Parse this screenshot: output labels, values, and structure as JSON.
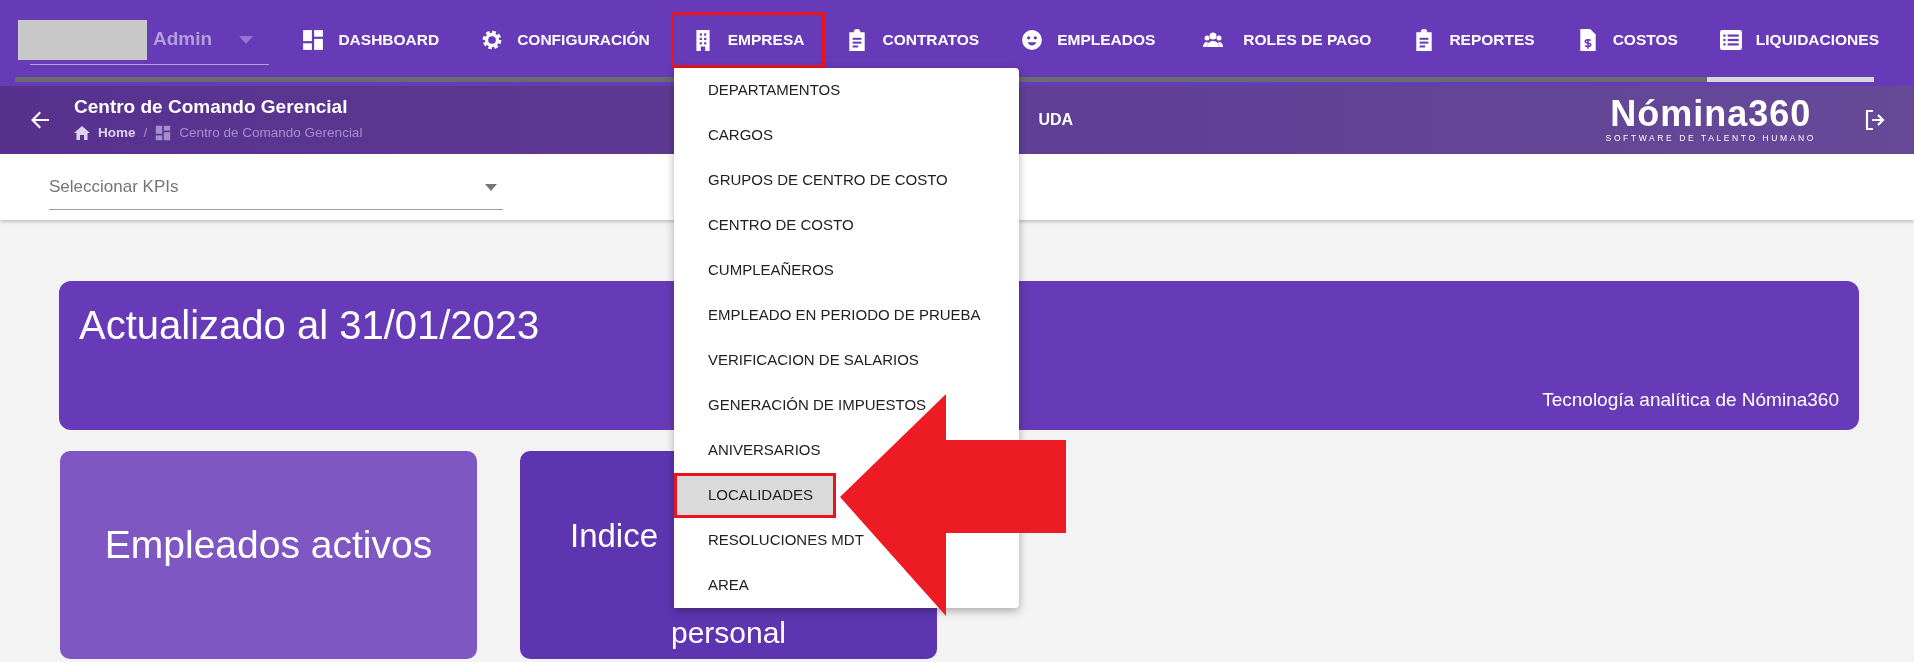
{
  "user": {
    "name": "Admin"
  },
  "nav": [
    {
      "label": "DASHBOARD",
      "highlighted": false
    },
    {
      "label": "CONFIGURACIÓN",
      "highlighted": false
    },
    {
      "label": "EMPRESA",
      "highlighted": true
    },
    {
      "label": "CONTRATOS",
      "highlighted": false
    },
    {
      "label": "EMPLEADOS",
      "highlighted": false
    },
    {
      "label": "ROLES DE PAGO",
      "highlighted": false
    },
    {
      "label": "REPORTES",
      "highlighted": false
    },
    {
      "label": "COSTOS",
      "highlighted": false
    },
    {
      "label": "LIQUIDACIONES",
      "highlighted": false
    }
  ],
  "progress": {
    "level": 0.91
  },
  "header": {
    "title": "Centro de Comando Gerencial",
    "breadcrumb": [
      "Home",
      "/",
      "Centro de Comando Gerencial"
    ],
    "partial_link": "UDA",
    "logo": "Nómina360",
    "logo_tagline": "SOFTWARE DE TALENTO HUMANO"
  },
  "kpi_select": {
    "placeholder": "Seleccionar KPIs"
  },
  "banner": {
    "title": "Actualizado al 31/01/2023",
    "caption": "Tecnología analítica de Nómina360"
  },
  "cards": [
    {
      "lines": [
        "Empleados activos"
      ]
    },
    {
      "lines": [
        "Indice",
        "personal"
      ]
    }
  ],
  "dropdown": [
    {
      "label": "DEPARTAMENTOS",
      "highlighted": false
    },
    {
      "label": "CARGOS",
      "highlighted": false
    },
    {
      "label": "GRUPOS DE CENTRO DE COSTO",
      "highlighted": false
    },
    {
      "label": "CENTRO DE COSTO",
      "highlighted": false
    },
    {
      "label": "CUMPLEAÑEROS",
      "highlighted": false
    },
    {
      "label": "EMPLEADO EN PERIODO DE PRUEBA",
      "highlighted": false
    },
    {
      "label": "VERIFICACION DE SALARIOS",
      "highlighted": false
    },
    {
      "label": "GENERACIÓN DE IMPUESTOS",
      "highlighted": false
    },
    {
      "label": "ANIVERSARIOS",
      "highlighted": false
    },
    {
      "label": "LOCALIDADES",
      "highlighted": true
    },
    {
      "label": "RESOLUCIONES MDT",
      "highlighted": false
    },
    {
      "label": "AREA",
      "highlighted": false
    }
  ]
}
